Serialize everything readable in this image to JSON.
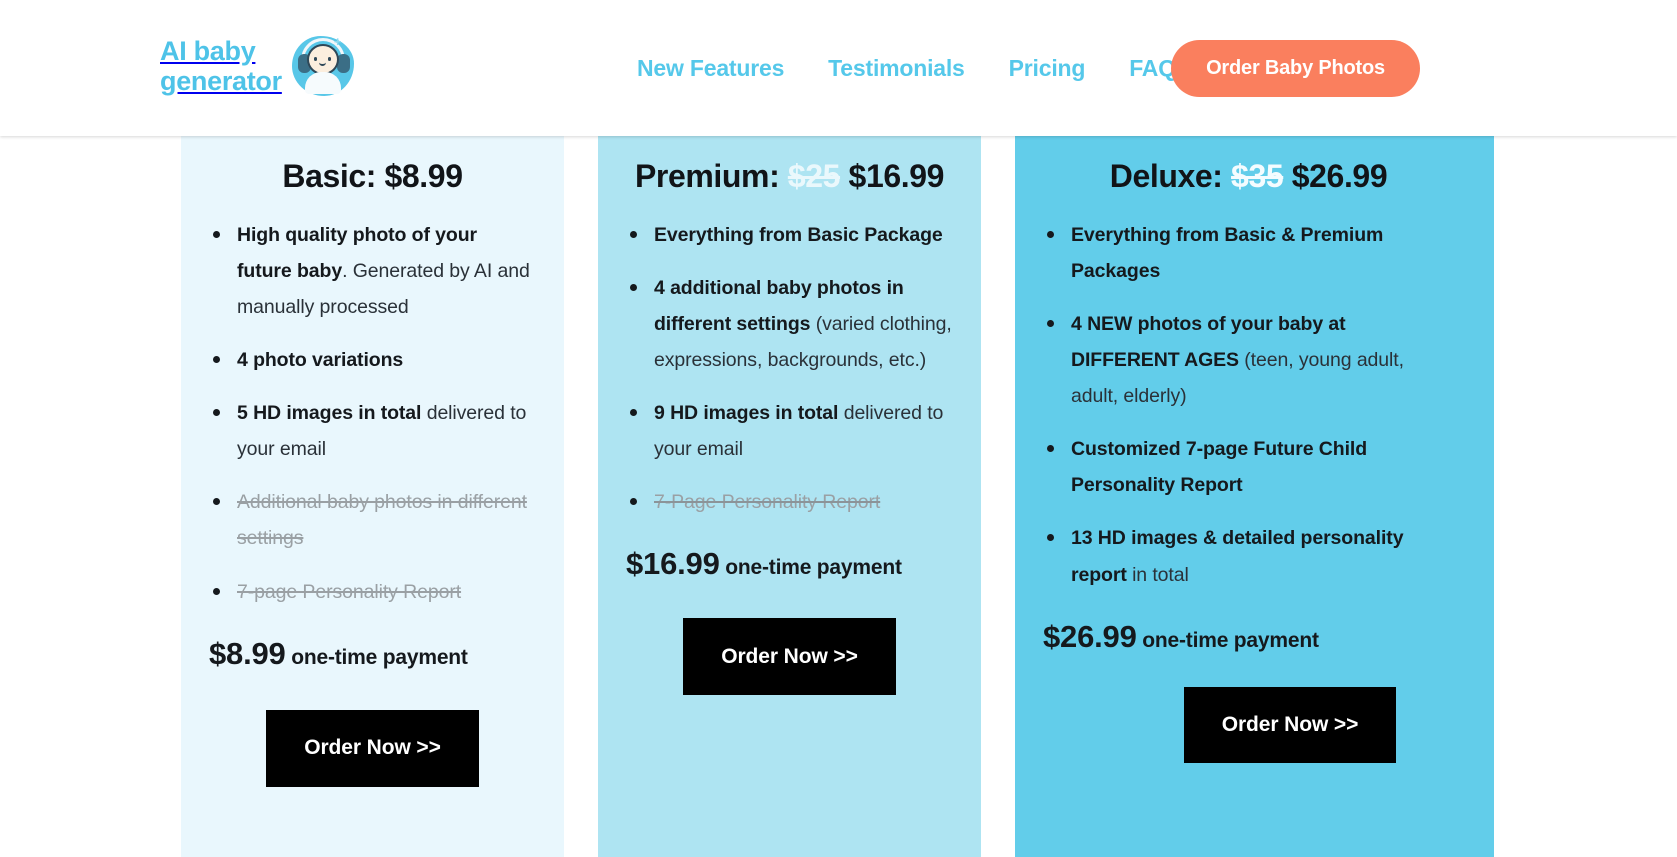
{
  "header": {
    "brand": {
      "name": "AI baby\ngenerator",
      "logo_icon": "baby-headphones-icon"
    },
    "nav": [
      {
        "id": "new-features",
        "label": "New Features"
      },
      {
        "id": "testimonials",
        "label": "Testimonials"
      },
      {
        "id": "pricing",
        "label": "Pricing"
      },
      {
        "id": "faq",
        "label": "FAQ"
      }
    ],
    "cta": {
      "label": "Order Baby Photos",
      "color": "#fa7f5e"
    }
  },
  "pricing": {
    "order_button_label": "Order Now >>",
    "payment_suffix": "one-time payment",
    "plans": [
      {
        "id": "basic",
        "title_prefix": "Basic: ",
        "old_price": "",
        "price": "$8.99",
        "bg_color": "#e9f7fd",
        "payment_amount": "$8.99",
        "features": [
          {
            "bold": "High quality photo of your future baby",
            "rest": ". Generated by AI and manually processed",
            "struck": false
          },
          {
            "bold": "4 photo variations",
            "rest": "",
            "struck": false
          },
          {
            "bold": "5 HD images in total",
            "rest": " delivered to your email",
            "struck": false
          },
          {
            "bold": "Additional baby photos in different settings",
            "rest": "",
            "struck": true
          },
          {
            "bold": "7-page Personality Report",
            "rest": "",
            "struck": true
          }
        ]
      },
      {
        "id": "premium",
        "title_prefix": "Premium: ",
        "old_price": "$25",
        "price": "$16.99",
        "bg_color": "#aee4f2",
        "payment_amount": "$16.99",
        "features": [
          {
            "bold": "Everything from Basic Package",
            "rest": "",
            "struck": false
          },
          {
            "bold": "4 additional baby photos in different settings",
            "rest": " (varied clothing, expressions, backgrounds, etc.)",
            "struck": false
          },
          {
            "bold": "9 HD images in total",
            "rest": " delivered to your email",
            "struck": false
          },
          {
            "bold": "7-Page Personality Report",
            "rest": "",
            "struck": true
          }
        ]
      },
      {
        "id": "deluxe",
        "title_prefix": "Deluxe: ",
        "old_price": "$35",
        "price": "$26.99",
        "bg_color": "#62cdea",
        "payment_amount": "$26.99",
        "features": [
          {
            "bold": "Everything from Basic & Premium Packages",
            "rest": "",
            "struck": false
          },
          {
            "bold": "4 NEW photos of your baby at DIFFERENT AGES",
            "rest": " (teen, young adult, adult, elderly)",
            "struck": false
          },
          {
            "bold": "Customized 7-page Future Child Personality Report",
            "rest": "",
            "struck": false
          },
          {
            "bold": "13 HD images & detailed personality report",
            "rest": " in total",
            "struck": false
          }
        ]
      }
    ]
  }
}
